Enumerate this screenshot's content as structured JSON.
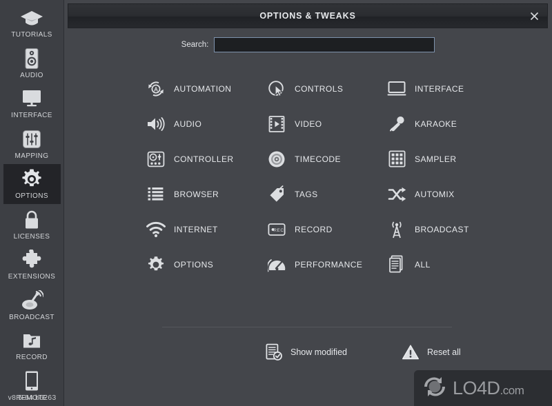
{
  "window": {
    "title": "OPTIONS & TWEAKS",
    "close_icon": "close-icon"
  },
  "colors": {
    "app_background": "#44464b",
    "sidebar_background": "#3d3f44",
    "sidebar_active": "#232428",
    "titlebar": "#27292d",
    "input_border": "#7e93ad",
    "input_background": "#1d1f22",
    "text": "#e6e8eb",
    "divider": "#55575c",
    "watermark_background": "#2c2e32"
  },
  "sidebar": {
    "items": [
      {
        "label": "TUTORIALS",
        "icon": "graduation-cap-icon",
        "active": false
      },
      {
        "label": "AUDIO",
        "icon": "speaker-icon",
        "active": false
      },
      {
        "label": "INTERFACE",
        "icon": "monitor-icon",
        "active": false
      },
      {
        "label": "MAPPING",
        "icon": "sliders-icon",
        "active": false
      },
      {
        "label": "OPTIONS",
        "icon": "gear-icon",
        "active": true
      },
      {
        "label": "LICENSES",
        "icon": "lock-icon",
        "active": false
      },
      {
        "label": "EXTENSIONS",
        "icon": "puzzle-piece-icon",
        "active": false
      },
      {
        "label": "BROADCAST",
        "icon": "satellite-dish-icon",
        "active": false
      },
      {
        "label": "RECORD",
        "icon": "music-folder-icon",
        "active": false
      },
      {
        "label": "REMOTE",
        "icon": "tablet-icon",
        "active": false
      }
    ],
    "version": "v8.5-64 b6263"
  },
  "search": {
    "label": "Search:",
    "value": "",
    "placeholder": ""
  },
  "grid": {
    "items": [
      {
        "label": "AUTOMATION",
        "icon": "automation-icon"
      },
      {
        "label": "CONTROLS",
        "icon": "cursor-controls-icon"
      },
      {
        "label": "INTERFACE",
        "icon": "monitor-icon"
      },
      {
        "label": "AUDIO",
        "icon": "volume-icon"
      },
      {
        "label": "VIDEO",
        "icon": "film-play-icon"
      },
      {
        "label": "KARAOKE",
        "icon": "microphone-icon"
      },
      {
        "label": "CONTROLLER",
        "icon": "dj-controller-icon"
      },
      {
        "label": "TIMECODE",
        "icon": "vinyl-record-icon"
      },
      {
        "label": "SAMPLER",
        "icon": "sampler-grid-icon"
      },
      {
        "label": "BROWSER",
        "icon": "list-icon"
      },
      {
        "label": "TAGS",
        "icon": "tag-icon"
      },
      {
        "label": "AUTOMIX",
        "icon": "shuffle-icon"
      },
      {
        "label": "INTERNET",
        "icon": "wifi-icon"
      },
      {
        "label": "RECORD",
        "icon": "rec-button-icon"
      },
      {
        "label": "BROADCAST",
        "icon": "antenna-icon"
      },
      {
        "label": "OPTIONS",
        "icon": "gear-icon"
      },
      {
        "label": "PERFORMANCE",
        "icon": "speedometer-icon"
      },
      {
        "label": "ALL",
        "icon": "documents-icon"
      }
    ]
  },
  "actions": [
    {
      "label": "Show modified",
      "icon": "document-check-icon"
    },
    {
      "label": "Reset all",
      "icon": "warning-triangle-icon"
    }
  ],
  "watermark": {
    "text": "LO4D",
    "suffix": ".com",
    "icon": "lo4d-logo-icon"
  }
}
